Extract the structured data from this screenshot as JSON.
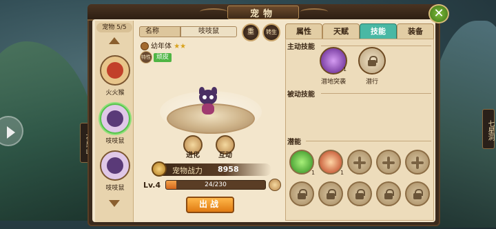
{
  "window": {
    "title": "宠物"
  },
  "side_tabs": {
    "left": "花果山",
    "right": "七星洞"
  },
  "pet_list": {
    "count": "宠物 5/5",
    "items": [
      {
        "name": "火火猴",
        "selected": false
      },
      {
        "name": "吱吱鼠",
        "selected": true
      },
      {
        "name": "吱吱鼠",
        "selected": false
      }
    ]
  },
  "pet_info": {
    "name_label": "名称",
    "name_value": "吱吱鼠",
    "reset_btn": "重",
    "reborn_btn": "转生",
    "stage": "幼年体",
    "stars": "★★",
    "trait_icon": "特性",
    "trait_tag": "顽皮",
    "evolve_label": "进化",
    "interact_label": "互动",
    "power_label": "宠物战力",
    "power_value": "8958",
    "level": "Lv.4",
    "exp_text": "24/230",
    "exp_fraction": 0.104,
    "fight_btn": "出战"
  },
  "tabs": [
    {
      "label": "属性",
      "active": false
    },
    {
      "label": "天赋",
      "active": false
    },
    {
      "label": "技能",
      "active": true
    },
    {
      "label": "装备",
      "active": false
    }
  ],
  "skills": {
    "active_title": "主动技能",
    "active": [
      {
        "name": "潜地突袭",
        "count": "1",
        "icon": "purple-swirl-icon"
      },
      {
        "name": "潜行",
        "count": "",
        "icon": "lock-icon"
      }
    ],
    "passive_title": "被动技能",
    "potential_title": "潜能",
    "potential_row1": [
      {
        "icon": "green-leaf-icon",
        "count": "1"
      },
      {
        "icon": "red-claw-icon",
        "count": "1"
      },
      {
        "icon": "plus-icon"
      },
      {
        "icon": "plus-icon"
      },
      {
        "icon": "plus-icon"
      }
    ],
    "potential_row2": [
      {
        "icon": "lock-icon"
      },
      {
        "icon": "lock-icon"
      },
      {
        "icon": "lock-icon"
      },
      {
        "icon": "lock-icon"
      },
      {
        "icon": "lock-icon"
      }
    ]
  },
  "colors": {
    "active_tab": "#49b8a4",
    "trait_tag": "#4fb544",
    "exp_fill": "#e07a12"
  }
}
